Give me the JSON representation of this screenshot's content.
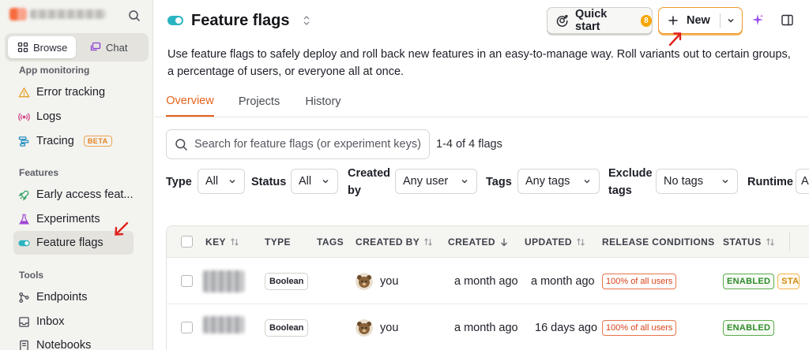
{
  "sidebar": {
    "modes": {
      "browse": "Browse",
      "chat": "Chat"
    },
    "sections": [
      {
        "title": "App monitoring"
      },
      {
        "title": "Features"
      },
      {
        "title": "Tools"
      }
    ],
    "items": [
      {
        "label": "Error tracking",
        "icon": "warning-icon"
      },
      {
        "label": "Logs",
        "icon": "broadcast-icon"
      },
      {
        "label": "Tracing",
        "icon": "tracing-icon",
        "badge": "BETA"
      },
      {
        "label": "Early access feat...",
        "icon": "rocket-icon"
      },
      {
        "label": "Experiments",
        "icon": "flask-icon"
      },
      {
        "label": "Feature flags",
        "icon": "toggle-icon",
        "active": true
      },
      {
        "label": "Endpoints",
        "icon": "endpoints-icon"
      },
      {
        "label": "Inbox",
        "icon": "inbox-icon"
      },
      {
        "label": "Notebooks",
        "icon": "notebook-icon"
      }
    ]
  },
  "header": {
    "title": "Feature flags",
    "quick_start": {
      "label": "Quick start",
      "count": "8"
    },
    "new_button": {
      "label": "New"
    }
  },
  "description": "Use feature flags to safely deploy and roll back new features in an easy-to-manage way. Roll variants out to certain groups, a percentage of users, or everyone all at once.",
  "tabs": [
    "Overview",
    "Projects",
    "History"
  ],
  "search": {
    "placeholder": "Search for feature flags (or experiment keys)",
    "count_text": "1-4 of 4 flags"
  },
  "filters": {
    "type": {
      "label": "Type",
      "value": "All"
    },
    "status": {
      "label": "Status",
      "value": "All"
    },
    "created_by": {
      "label_line1": "Created",
      "label_line2": "by",
      "value": "Any user"
    },
    "tags": {
      "label": "Tags",
      "value": "Any tags"
    },
    "exclude_tags": {
      "label_line1": "Exclude",
      "label_line2": "tags",
      "value": "No tags"
    },
    "runtime": {
      "label": "Runtime",
      "value": "A"
    }
  },
  "table": {
    "columns": [
      "KEY",
      "TYPE",
      "TAGS",
      "CREATED BY",
      "CREATED",
      "UPDATED",
      "RELEASE CONDITIONS",
      "STATUS"
    ],
    "rows": [
      {
        "type": "Boolean",
        "created_by": "you",
        "created": "a month ago",
        "updated": "a month ago",
        "release": "100% of all users",
        "status": "ENABLED",
        "extra_status": "STA"
      },
      {
        "type": "Boolean",
        "created_by": "you",
        "created": "a month ago",
        "updated": "16 days ago",
        "release": "100% of all users",
        "status": "ENABLED"
      }
    ]
  },
  "colors": {
    "accent": "#e5621b",
    "new_button_border": "#f09a2e",
    "enabled": "#2f8a2b",
    "release": "#d8431b",
    "flag_icon": "#2ab3c1"
  }
}
